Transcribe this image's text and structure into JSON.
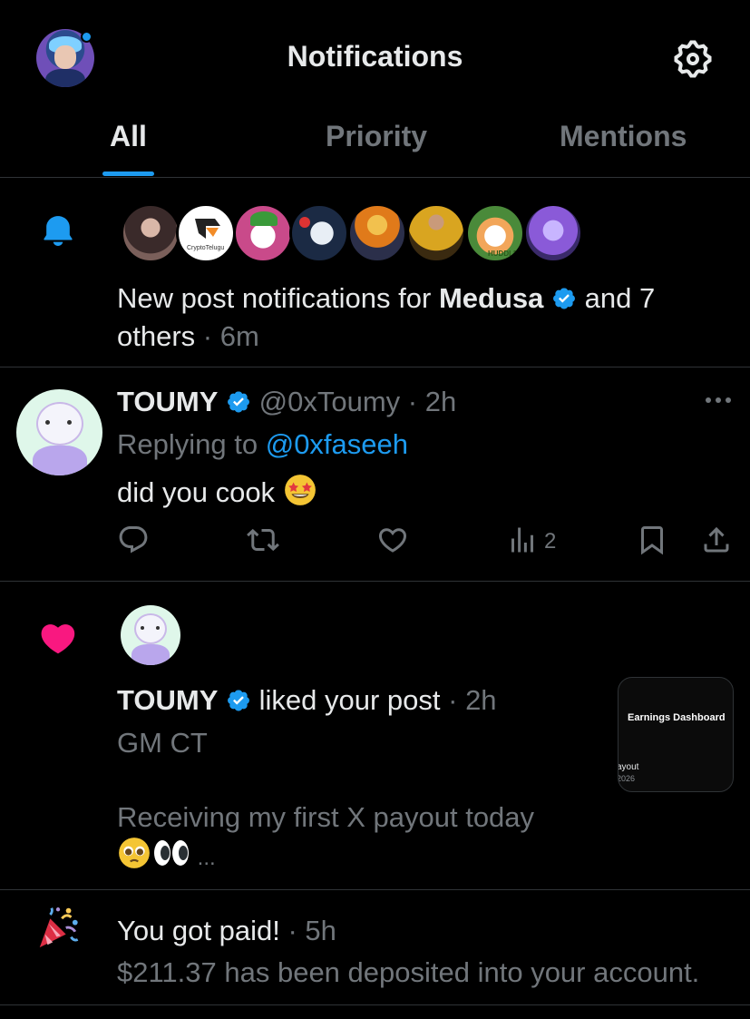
{
  "header": {
    "title": "Notifications"
  },
  "tabs": [
    {
      "label": "All",
      "active": true
    },
    {
      "label": "Priority",
      "active": false
    },
    {
      "label": "Mentions",
      "active": false
    }
  ],
  "notif_posts": {
    "text_prefix": "New post notifications for ",
    "name": "Medusa",
    "text_suffix": " and 7",
    "text_line2": "others",
    "time": " · 6m",
    "avatar_badge": "CryptoTelugu",
    "avatar_badge2": "HUDDLE"
  },
  "reply": {
    "name": "TOUMY",
    "handle": "@0xToumy",
    "time": " · 2h",
    "replying_to_label": "Replying to ",
    "replying_to_handle": "@0xfaseeh",
    "text": "did you cook ",
    "views": "2"
  },
  "like": {
    "name": "TOUMY",
    "action": " liked your post",
    "time": " · 2h",
    "post_line1": "GM CT",
    "post_line2": "Receiving my first X payout today",
    "ellipsis": " ...",
    "thumb_title": "Earnings Dashboard",
    "thumb_sub": "ayout",
    "thumb_year": "2026"
  },
  "paid": {
    "title": "You got paid!",
    "time": " · 5h",
    "text": "$211.37 has been deposited into your account."
  },
  "colors": {
    "accent": "#1d9bf0",
    "like": "#f91880",
    "muted": "#71767b"
  }
}
